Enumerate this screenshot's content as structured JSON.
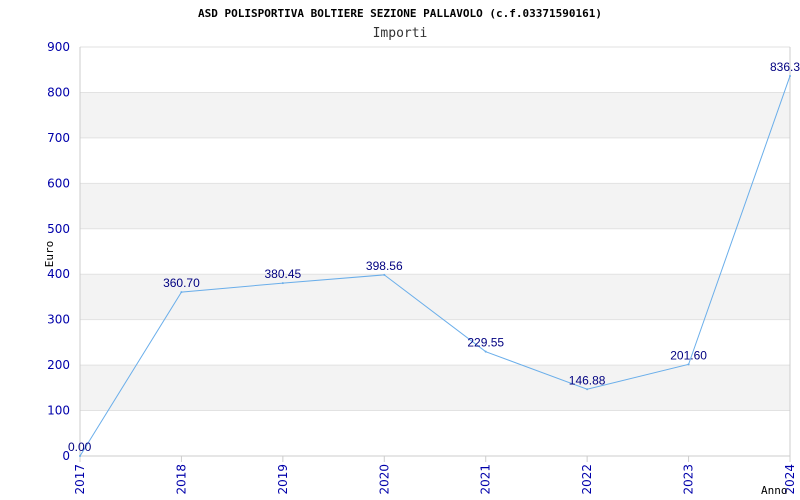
{
  "chart_data": {
    "type": "line",
    "title": "ASD POLISPORTIVA BOLTIERE SEZIONE PALLAVOLO (c.f.03371590161)",
    "subtitle": "Importi",
    "xlabel": "Anno",
    "ylabel": "Euro",
    "ylim": [
      0,
      900
    ],
    "yticks": [
      "0",
      "100",
      "200",
      "300",
      "400",
      "500",
      "600",
      "700",
      "800",
      "900"
    ],
    "grid": true,
    "categories": [
      "2017",
      "2018",
      "2019",
      "2020",
      "2021",
      "2022",
      "2023",
      "2024"
    ],
    "values": [
      0.0,
      360.7,
      380.45,
      398.56,
      229.55,
      146.88,
      201.6,
      836.3
    ],
    "value_labels": [
      "0.00",
      "360.70",
      "380.45",
      "398.56",
      "229.55",
      "146.88",
      "201.60",
      "836.3"
    ],
    "colors": {
      "line": "#6aaeea",
      "band": "#f3f3f3",
      "axis": "#cccccc",
      "tick_text": "#0000aa",
      "label_text": "#000080"
    }
  }
}
